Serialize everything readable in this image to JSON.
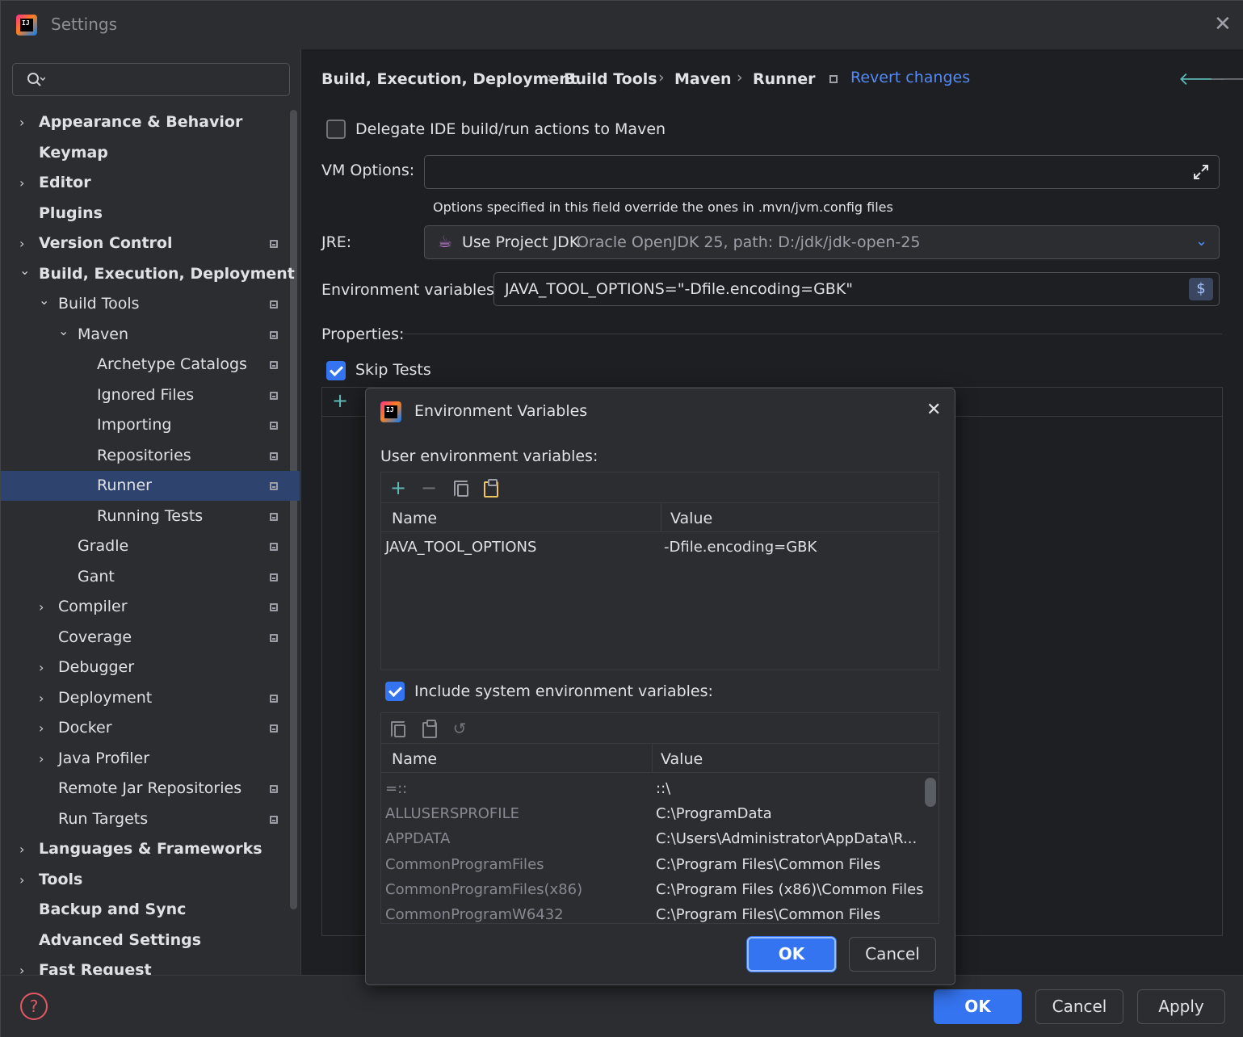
{
  "window": {
    "title": "Settings"
  },
  "sidebar": {
    "search_placeholder": "",
    "items": [
      {
        "label": "Appearance & Behavior"
      },
      {
        "label": "Keymap"
      },
      {
        "label": "Editor"
      },
      {
        "label": "Plugins"
      },
      {
        "label": "Version Control"
      },
      {
        "label": "Build, Execution, Deployment"
      },
      {
        "label": "Build Tools"
      },
      {
        "label": "Maven"
      },
      {
        "label": "Archetype Catalogs"
      },
      {
        "label": "Ignored Files"
      },
      {
        "label": "Importing"
      },
      {
        "label": "Repositories"
      },
      {
        "label": "Runner"
      },
      {
        "label": "Running Tests"
      },
      {
        "label": "Gradle"
      },
      {
        "label": "Gant"
      },
      {
        "label": "Compiler"
      },
      {
        "label": "Coverage"
      },
      {
        "label": "Debugger"
      },
      {
        "label": "Deployment"
      },
      {
        "label": "Docker"
      },
      {
        "label": "Java Profiler"
      },
      {
        "label": "Remote Jar Repositories"
      },
      {
        "label": "Run Targets"
      },
      {
        "label": "Languages & Frameworks"
      },
      {
        "label": "Tools"
      },
      {
        "label": "Backup and Sync"
      },
      {
        "label": "Advanced Settings"
      },
      {
        "label": "Fast Request"
      }
    ]
  },
  "breadcrumb": {
    "parts": [
      "Build, Execution, Deployment",
      "Build Tools",
      "Maven",
      "Runner"
    ],
    "separator": "›",
    "revert_label": "Revert changes"
  },
  "runner": {
    "delegate_label": "Delegate IDE build/run actions to Maven",
    "delegate_checked": false,
    "vm_options_label": "VM Options:",
    "vm_options_value": "",
    "vm_hint": "Options specified in this field override the ones in .mvn/jvm.config files",
    "jre_label": "JRE:",
    "jre_value": "Use Project JDK",
    "jre_detail": "Oracle OpenJDK 25, path: D:/jdk/jdk-open-25",
    "env_label": "Environment variables:",
    "env_value": "JAVA_TOOL_OPTIONS=\"-Dfile.encoding=GBK\"",
    "env_button": "$",
    "properties_label": "Properties:",
    "skip_tests_label": "Skip Tests",
    "skip_tests_checked": true,
    "add_symbol": "+"
  },
  "dialog": {
    "title": "Environment Variables",
    "user_vars_label": "User environment variables:",
    "user_cols": [
      "Name",
      "Value"
    ],
    "user_rows": [
      {
        "name": "JAVA_TOOL_OPTIONS",
        "value": "-Dfile.encoding=GBK"
      }
    ],
    "include_system_label": "Include system environment variables:",
    "include_system_checked": true,
    "system_cols": [
      "Name",
      "Value"
    ],
    "system_rows": [
      {
        "name": "=::",
        "value": "::\\"
      },
      {
        "name": "ALLUSERSPROFILE",
        "value": "C:\\ProgramData"
      },
      {
        "name": "APPDATA",
        "value": "C:\\Users\\Administrator\\AppData\\R..."
      },
      {
        "name": "CommonProgramFiles",
        "value": "C:\\Program Files\\Common Files"
      },
      {
        "name": "CommonProgramFiles(x86)",
        "value": "C:\\Program Files (x86)\\Common Files"
      },
      {
        "name": "CommonProgramW6432",
        "value": "C:\\Program Files\\Common Files"
      }
    ],
    "ok_label": "OK",
    "cancel_label": "Cancel"
  },
  "footer": {
    "ok_label": "OK",
    "cancel_label": "Cancel",
    "apply_label": "Apply",
    "help_symbol": "?"
  },
  "colors": {
    "accent": "#3574f0",
    "link": "#548af7",
    "selection": "#2e436e",
    "add_green": "#5fb865"
  }
}
